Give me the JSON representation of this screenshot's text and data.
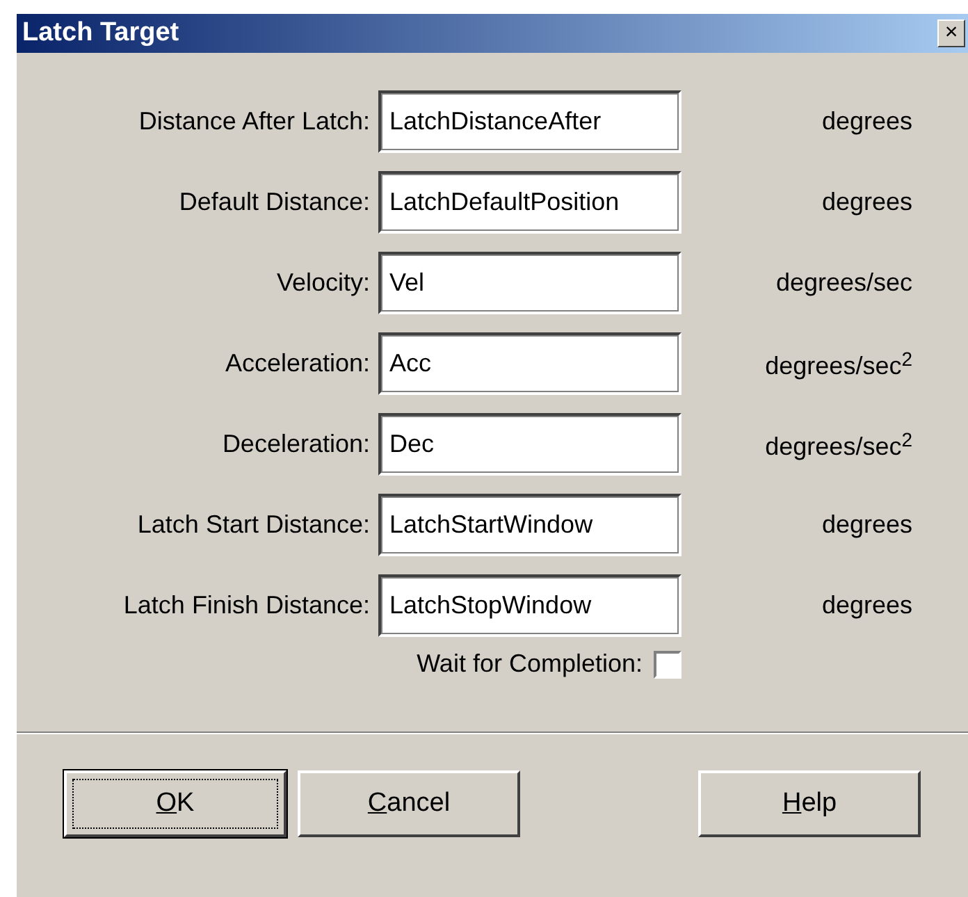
{
  "window": {
    "title": "Latch Target",
    "close": "×"
  },
  "fields": [
    {
      "label": "Distance After Latch:",
      "value": "LatchDistanceAfter",
      "unit": "degrees"
    },
    {
      "label": "Default Distance:",
      "value": "LatchDefaultPosition",
      "unit": "degrees"
    },
    {
      "label": "Velocity:",
      "value": "Vel",
      "unit": "degrees/sec"
    },
    {
      "label": "Acceleration:",
      "value": "Acc",
      "unit": "degrees/sec$^{2}$"
    },
    {
      "label": "Deceleration:",
      "value": "Dec",
      "unit": "degrees/sec$^{2}$"
    },
    {
      "label": "Latch Start Distance:",
      "value": "LatchStartWindow",
      "unit": "degrees"
    },
    {
      "label": "Latch Finish Distance:",
      "value": "LatchStopWindow",
      "unit": "degrees"
    }
  ],
  "wait_for_completion": {
    "label": "Wait for Completion:",
    "checked": false
  },
  "buttons": [
    {
      "label": "OK",
      "default": true
    },
    {
      "label": "Cancel",
      "default": false
    },
    {
      "label": "Help",
      "default": false
    }
  ]
}
